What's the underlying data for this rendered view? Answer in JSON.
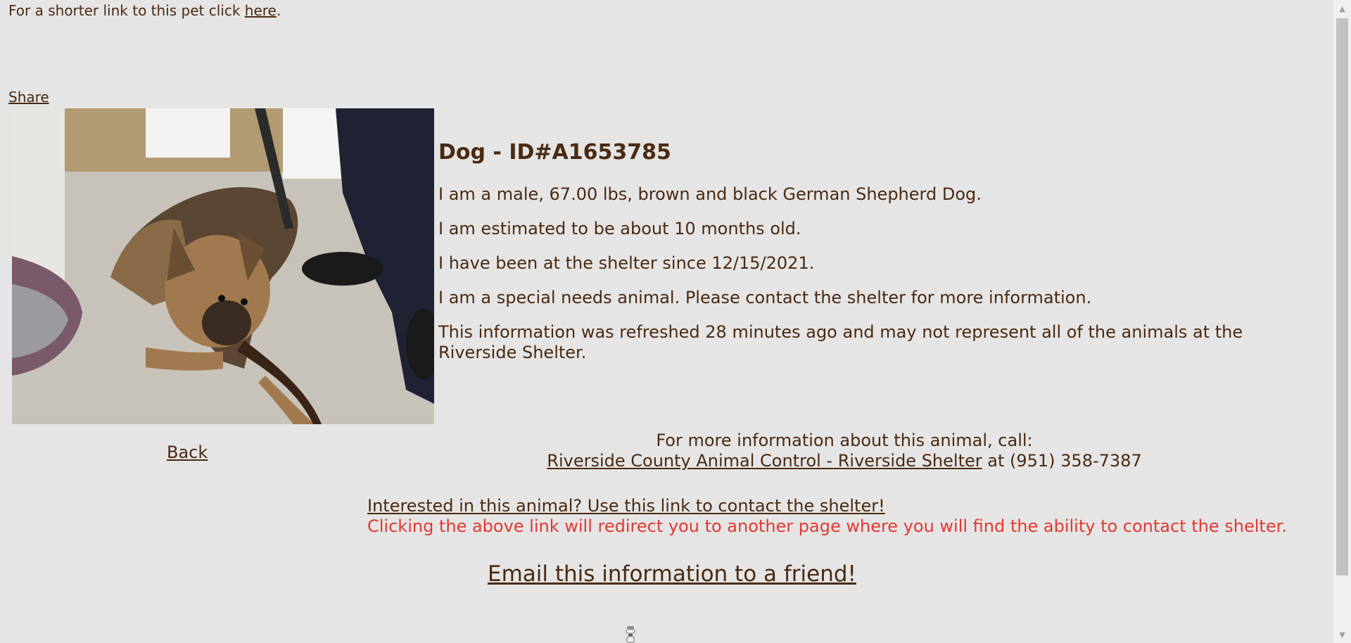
{
  "header": {
    "short_link_prefix": "For a shorter link to this pet click ",
    "short_link_text": "here",
    "short_link_suffix": ".",
    "share_label": "Share"
  },
  "pet": {
    "title": "Dog - ID#A1653785",
    "description": "I am a male, 67.00 lbs, brown and black German Shepherd Dog.",
    "age": "I am estimated to be about 10 months old.",
    "since": "I have been at the shelter since 12/15/2021.",
    "special_needs": "I am a special needs animal. Please contact the shelter for more information.",
    "refreshed": "This information was refreshed 28 minutes ago and may not represent all of the animals at the Riverside Shelter."
  },
  "nav": {
    "back_label": "Back"
  },
  "contact": {
    "call_intro": "For more information about this animal, call:",
    "shelter_name": "Riverside County Animal Control - Riverside Shelter",
    "phone_text": " at (951) 358-7387",
    "interest_link": "Interested in this animal? Use this link to contact the shelter!",
    "redirect_note": "Clicking the above link will redirect you to another page where you will find the ability to contact the shelter.",
    "email_link": "Email this information to a friend!"
  },
  "icons": {
    "photo": "dog-photo",
    "loading": "loading-spinner-icon"
  },
  "colors": {
    "background": "#e5e5e5",
    "text": "#4a2a12",
    "warning": "#e03a32"
  }
}
